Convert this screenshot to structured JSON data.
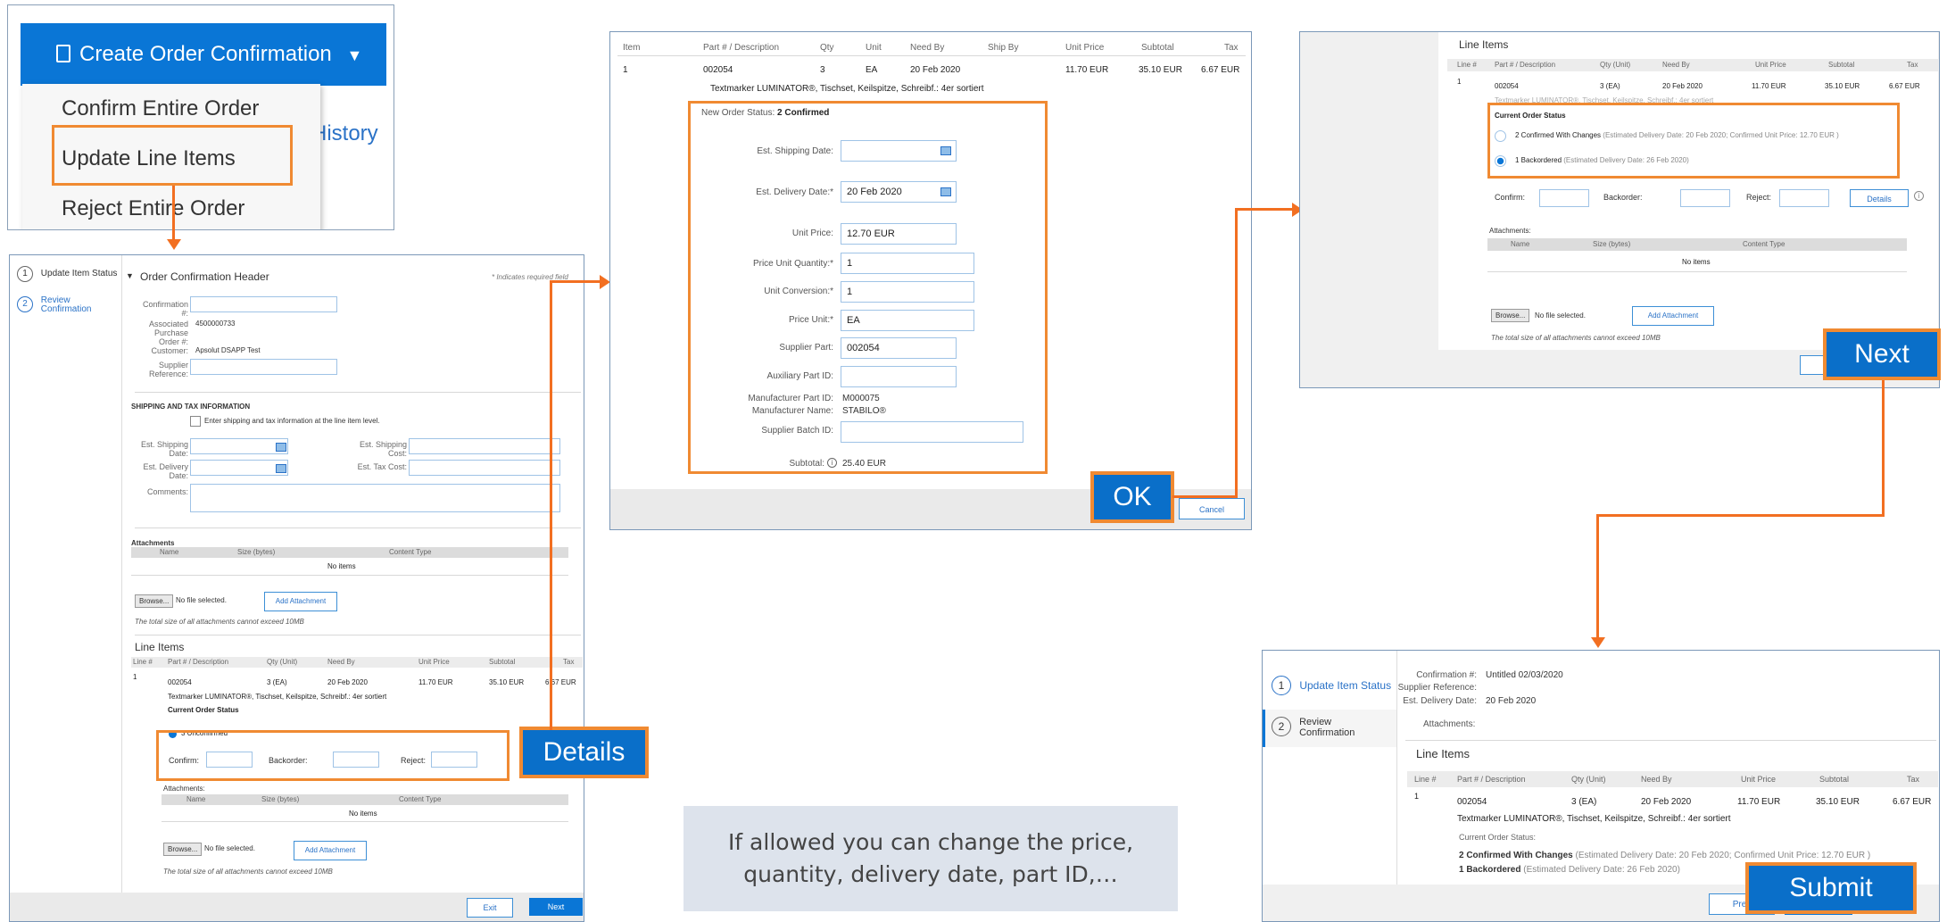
{
  "menu": {
    "button": "Create Order Confirmation",
    "items": [
      "Confirm Entire Order",
      "Update Line Items",
      "Reject Entire Order"
    ],
    "history": "History"
  },
  "steps": {
    "s1": "Update Item Status",
    "s2": "Review Confirmation",
    "n1": "1",
    "n2": "2"
  },
  "header": {
    "title": "Order Confirmation Header",
    "required": "* Indicates required field",
    "confirmation": "Confirmation #:",
    "assoc": "Associated Purchase Order #:",
    "po": "4500000733",
    "customer_label": "Customer:",
    "customer": "Apsolut DSAPP Test",
    "supplier_ref": "Supplier Reference:"
  },
  "shipping": {
    "title": "SHIPPING AND TAX INFORMATION",
    "checkbox": "Enter shipping and tax information at the line item level.",
    "ship_date": "Est. Shipping Date:",
    "delivery_date": "Est. Delivery Date:",
    "ship_cost": "Est. Shipping Cost:",
    "tax_cost": "Est. Tax Cost:",
    "comments": "Comments:"
  },
  "attachments": {
    "title": "Attachments",
    "title2": "Attachments:",
    "name": "Name",
    "size": "Size (bytes)",
    "type": "Content Type",
    "none": "No items",
    "browse": "Browse...",
    "nofile": "No file selected.",
    "add": "Add Attachment",
    "limit": "The total size of all attachments cannot exceed 10MB"
  },
  "lineitems": {
    "title": "Line Items",
    "cols": [
      "Line #",
      "Part # / Description",
      "Qty (Unit)",
      "Need By",
      "Unit Price",
      "Subtotal",
      "Tax"
    ],
    "line": "1",
    "part": "002054",
    "qty": "3 (EA)",
    "needby": "20 Feb 2020",
    "price": "11.70 EUR",
    "subtotal": "35.10 EUR",
    "tax": "6.67 EUR",
    "desc": "Textmarker LUMINATOR®, Tischset, Keilspitze, Schreibf.: 4er sortiert",
    "status": "Current Order Status",
    "status2": "Current Order Status:",
    "unconfirmed": "3 Unconfirmed",
    "confirm": "Confirm:",
    "backorder": "Backorder:",
    "reject": "Reject:",
    "details": "Details"
  },
  "footer": {
    "exit": "Exit",
    "next": "Next",
    "prev": "Prev",
    "submit": "Submit"
  },
  "dialog": {
    "cols": [
      "Item",
      "Part # / Description",
      "Qty",
      "Unit",
      "Need By",
      "Ship By",
      "Unit Price",
      "Subtotal",
      "Tax"
    ],
    "item": "1",
    "part": "002054",
    "qty": "3",
    "unit": "EA",
    "needby": "20 Feb 2020",
    "price": "11.70 EUR",
    "subtotal": "35.10 EUR",
    "tax": "6.67 EUR",
    "desc": "Textmarker LUMINATOR®, Tischset, Keilspitze, Schreibf.: 4er sortiert",
    "status_label": "New Order Status:",
    "status": "2 Confirmed",
    "est_ship": "Est. Shipping Date:",
    "est_del": "Est. Delivery Date:*",
    "est_del_val": "20 Feb 2020",
    "unit_price": "Unit Price:",
    "unit_price_val": "12.70 EUR",
    "puq": "Price Unit Quantity:*",
    "puq_val": "1",
    "uc": "Unit Conversion:*",
    "uc_val": "1",
    "pu": "Price Unit:*",
    "pu_val": "EA",
    "sp": "Supplier Part:",
    "sp_val": "002054",
    "aux": "Auxiliary Part ID:",
    "mpid": "Manufacturer Part ID:",
    "mpid_val": "M000075",
    "mname": "Manufacturer Name:",
    "mname_val": "STABILO®",
    "batch": "Supplier Batch ID:",
    "subtotal_label": "Subtotal:",
    "subtotal_val": "25.40 EUR",
    "cancel": "Cancel"
  },
  "panel3": {
    "opt1": "2 Confirmed With Changes",
    "opt1_note": "(Estimated Delivery Date: 20 Feb 2020; Confirmed Unit Price: 12.70 EUR )",
    "opt2": "1 Backordered",
    "opt2_note": "(Estimated Delivery Date: 26 Feb 2020)"
  },
  "panel4": {
    "confirmation": "Confirmation #:",
    "confirmation_val": "Untitled 02/03/2020",
    "supplier_ref": "Supplier Reference:",
    "est_del": "Est. Delivery Date:",
    "est_del_val": "20 Feb 2020",
    "attachments": "Attachments:",
    "line1": "2 Confirmed With Changes",
    "line1_note": "(Estimated Delivery Date: 20 Feb 2020; Confirmed Unit Price: 12.70 EUR )",
    "line2": "1 Backordered",
    "line2_note": "(Estimated Delivery Date: 26 Feb 2020)"
  },
  "callouts": {
    "details": "Details",
    "ok": "OK",
    "next": "Next",
    "submit": "Submit"
  },
  "note": "If allowed you can change the price, quantity, delivery date, part ID,…",
  "colors": {
    "accent": "#0a6fc9",
    "highlight": "#f08a32",
    "connector": "#f26f21"
  }
}
